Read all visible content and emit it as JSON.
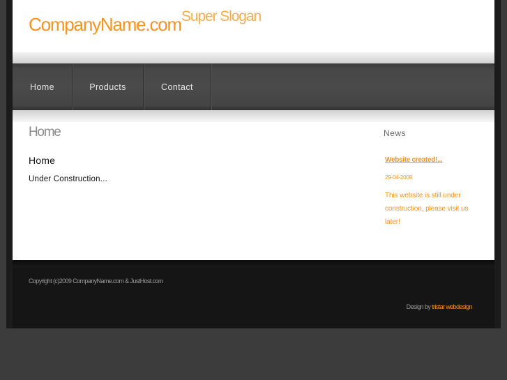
{
  "header": {
    "logo_name": "CompanyName.com",
    "slogan": "Super Slogan"
  },
  "nav": {
    "items": [
      {
        "label": "Home"
      },
      {
        "label": "Products"
      },
      {
        "label": "Contact"
      }
    ]
  },
  "main": {
    "page_heading": "Home",
    "section_title": "Home",
    "section_body": "Under Construction..."
  },
  "news": {
    "title": "News",
    "headline": "Website created!...",
    "date": "29-04-2009",
    "text": "This website is still under construction, please visit us later!"
  },
  "footer": {
    "copyright": "Copyright (c)2009 CompanyName.com & JustHost.com",
    "design_prefix": "Design by",
    "design_link": "tristar webdesign"
  },
  "colors": {
    "accent": "#f7931e",
    "nav_bg": "#474747",
    "footer_bg": "#151515",
    "page_bg": "#3c3c3c"
  }
}
